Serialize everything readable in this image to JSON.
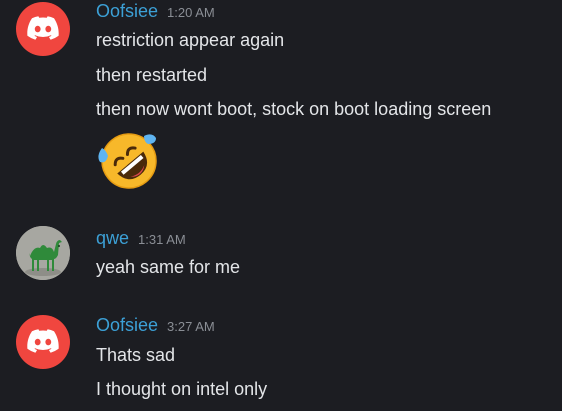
{
  "messages": [
    {
      "author": "Oofsiee",
      "time": "1:20 AM",
      "avatar_icon": "discord-logo-icon",
      "lines": [
        "restriction appear again",
        "then restarted",
        "then now wont boot, stock on boot loading screen"
      ],
      "emoji": "rolling-on-floor-laughing-emoji"
    },
    {
      "author": "qwe",
      "time": "1:31 AM",
      "avatar_icon": "camel-avatar-icon",
      "lines": [
        "yeah same for me"
      ]
    },
    {
      "author": "Oofsiee",
      "time": "3:27 AM",
      "avatar_icon": "discord-logo-icon",
      "lines": [
        "Thats sad",
        "I thought on intel only"
      ]
    }
  ],
  "colors": {
    "background": "#1c1d22",
    "username": "#3ca0d6",
    "timestamp": "#8a8e95",
    "discord_avatar": "#f0463f"
  }
}
